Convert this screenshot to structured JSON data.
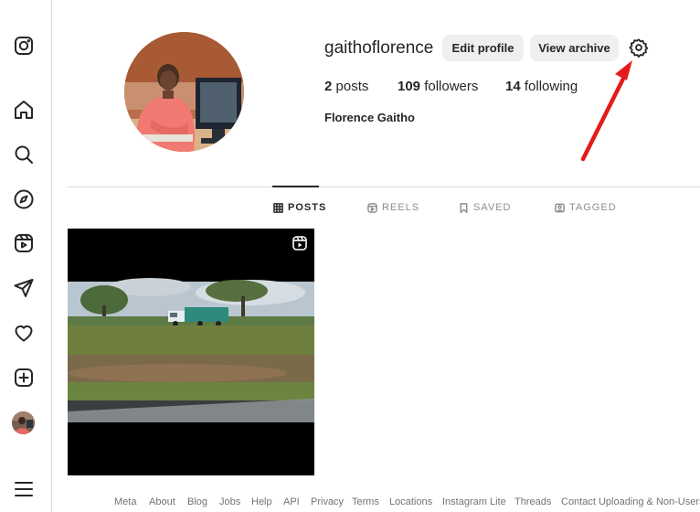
{
  "profile": {
    "username": "gaithoflorence",
    "edit_profile": "Edit profile",
    "view_archive": "View archive",
    "full_name": "Florence Gaitho",
    "posts_count": "2",
    "posts_label": "posts",
    "followers_count": "109",
    "followers_label": "followers",
    "following_count": "14",
    "following_label": "following"
  },
  "tabs": {
    "posts": "POSTS",
    "reels": "REELS",
    "saved": "SAVED",
    "tagged": "TAGGED"
  },
  "footer": [
    "Meta",
    "About",
    "Blog",
    "Jobs",
    "Help",
    "API",
    "Privacy",
    "Terms",
    "Locations",
    "Instagram Lite",
    "Threads",
    "Contact Uploading & Non-Users"
  ],
  "colors": {
    "annotation_arrow": "#e41b1b",
    "divider": "#dbdbdb",
    "button_bg": "#efefef"
  },
  "icons": {
    "sidebar": [
      "instagram-icon",
      "home-icon",
      "search-icon",
      "explore-icon",
      "reels-icon",
      "messages-icon",
      "notifications-icon",
      "create-icon",
      "profile-avatar",
      "menu-icon"
    ],
    "settings": "gear-icon"
  }
}
